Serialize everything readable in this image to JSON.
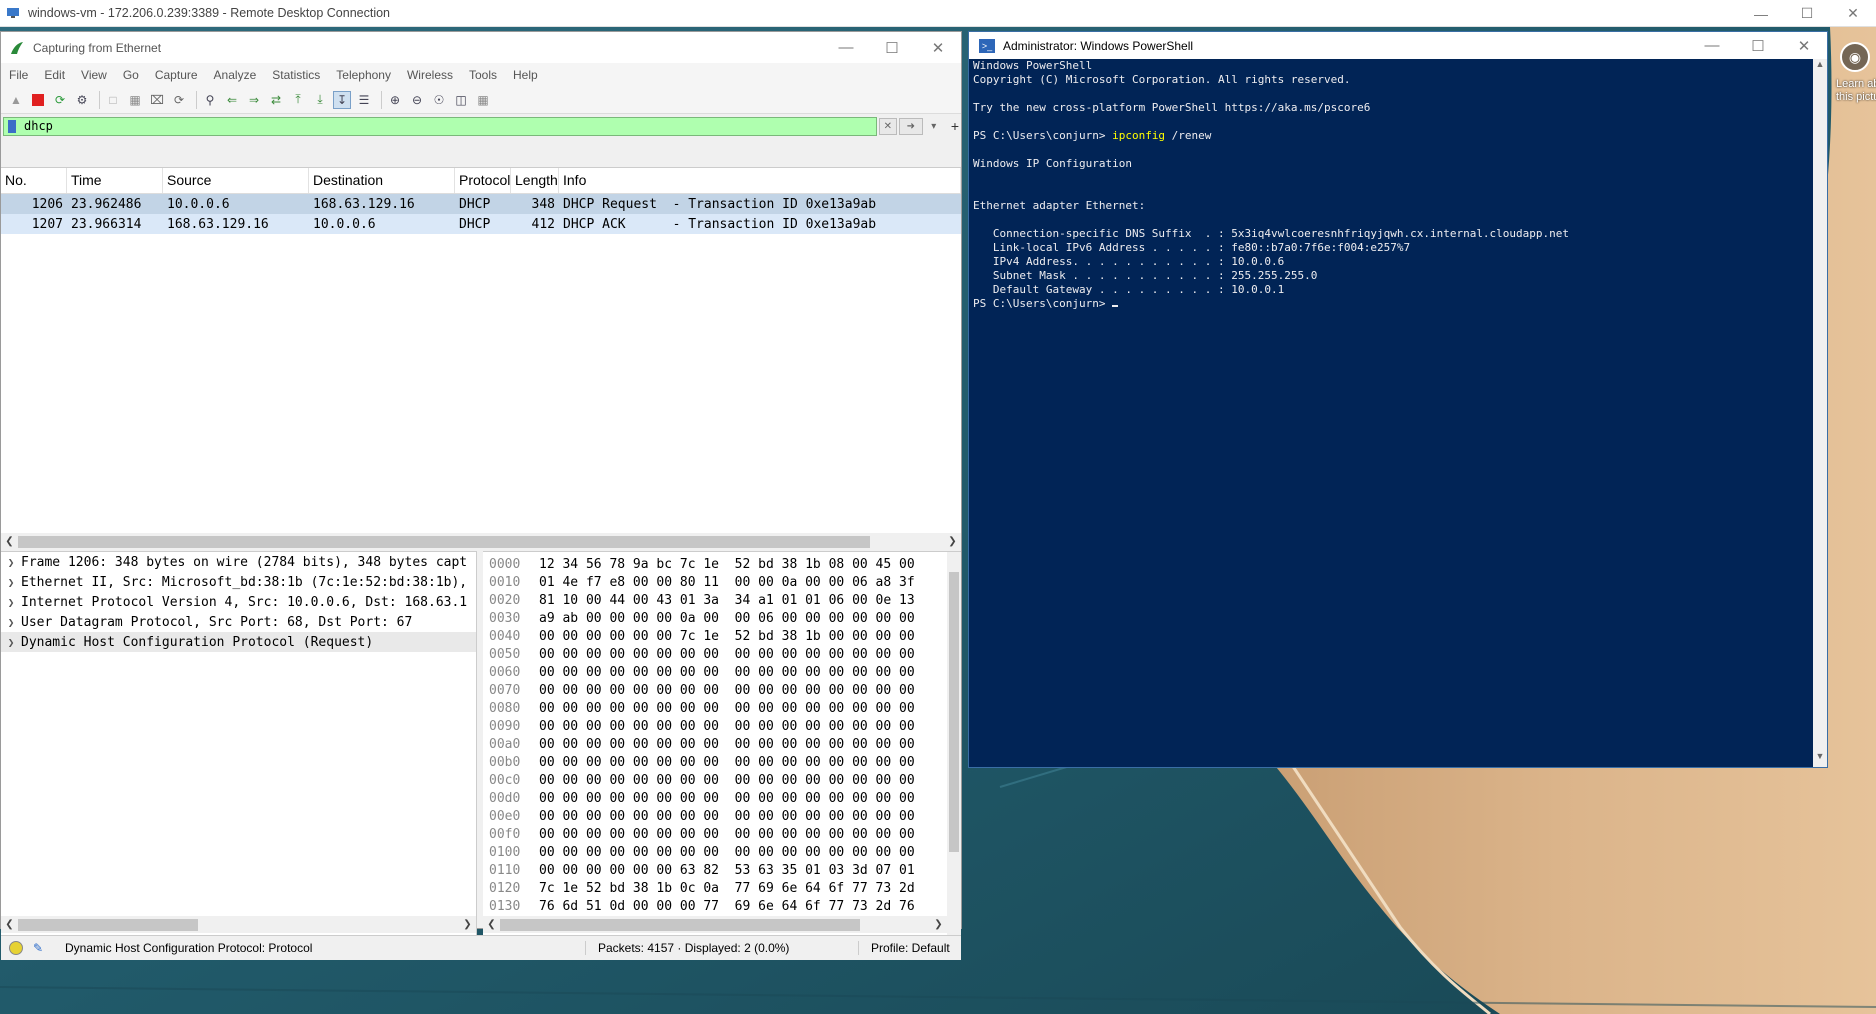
{
  "rdp": {
    "title": "windows-vm - 172.206.0.239:3389 - Remote Desktop Connection"
  },
  "wireshark": {
    "title": "Capturing from Ethernet",
    "menu": [
      "File",
      "Edit",
      "View",
      "Go",
      "Capture",
      "Analyze",
      "Statistics",
      "Telephony",
      "Wireless",
      "Tools",
      "Help"
    ],
    "filter": "dhcp",
    "columns": [
      "No.",
      "Time",
      "Source",
      "Destination",
      "Protocol",
      "Length",
      "Info"
    ],
    "packets": [
      {
        "no": "1206",
        "time": "23.962486",
        "src": "10.0.0.6",
        "dst": "168.63.129.16",
        "proto": "DHCP",
        "len": "348",
        "info": "DHCP Request  - Transaction ID 0xe13a9ab"
      },
      {
        "no": "1207",
        "time": "23.966314",
        "src": "168.63.129.16",
        "dst": "10.0.0.6",
        "proto": "DHCP",
        "len": "412",
        "info": "DHCP ACK      - Transaction ID 0xe13a9ab"
      }
    ],
    "details": [
      "Frame 1206: 348 bytes on wire (2784 bits), 348 bytes capt",
      "Ethernet II, Src: Microsoft_bd:38:1b (7c:1e:52:bd:38:1b),",
      "Internet Protocol Version 4, Src: 10.0.0.6, Dst: 168.63.1",
      "User Datagram Protocol, Src Port: 68, Dst Port: 67",
      "Dynamic Host Configuration Protocol (Request)"
    ],
    "bytes": [
      {
        "off": "0000",
        "hex": "12 34 56 78 9a bc 7c 1e  52 bd 38 1b 08 00 45 00"
      },
      {
        "off": "0010",
        "hex": "01 4e f7 e8 00 00 80 11  00 00 0a 00 00 06 a8 3f"
      },
      {
        "off": "0020",
        "hex": "81 10 00 44 00 43 01 3a  34 a1 01 01 06 00 0e 13"
      },
      {
        "off": "0030",
        "hex": "a9 ab 00 00 00 00 0a 00  00 06 00 00 00 00 00 00"
      },
      {
        "off": "0040",
        "hex": "00 00 00 00 00 00 7c 1e  52 bd 38 1b 00 00 00 00"
      },
      {
        "off": "0050",
        "hex": "00 00 00 00 00 00 00 00  00 00 00 00 00 00 00 00"
      },
      {
        "off": "0060",
        "hex": "00 00 00 00 00 00 00 00  00 00 00 00 00 00 00 00"
      },
      {
        "off": "0070",
        "hex": "00 00 00 00 00 00 00 00  00 00 00 00 00 00 00 00"
      },
      {
        "off": "0080",
        "hex": "00 00 00 00 00 00 00 00  00 00 00 00 00 00 00 00"
      },
      {
        "off": "0090",
        "hex": "00 00 00 00 00 00 00 00  00 00 00 00 00 00 00 00"
      },
      {
        "off": "00a0",
        "hex": "00 00 00 00 00 00 00 00  00 00 00 00 00 00 00 00"
      },
      {
        "off": "00b0",
        "hex": "00 00 00 00 00 00 00 00  00 00 00 00 00 00 00 00"
      },
      {
        "off": "00c0",
        "hex": "00 00 00 00 00 00 00 00  00 00 00 00 00 00 00 00"
      },
      {
        "off": "00d0",
        "hex": "00 00 00 00 00 00 00 00  00 00 00 00 00 00 00 00"
      },
      {
        "off": "00e0",
        "hex": "00 00 00 00 00 00 00 00  00 00 00 00 00 00 00 00"
      },
      {
        "off": "00f0",
        "hex": "00 00 00 00 00 00 00 00  00 00 00 00 00 00 00 00"
      },
      {
        "off": "0100",
        "hex": "00 00 00 00 00 00 00 00  00 00 00 00 00 00 00 00"
      },
      {
        "off": "0110",
        "hex": "00 00 00 00 00 00 63 82  53 63 35 01 03 3d 07 01"
      },
      {
        "off": "0120",
        "hex": "7c 1e 52 bd 38 1b 0c 0a  77 69 6e 64 6f 77 73 2d"
      },
      {
        "off": "0130",
        "hex": "76 6d 51 0d 00 00 00 77  69 6e 64 6f 77 73 2d 76"
      }
    ],
    "status": {
      "field": "Dynamic Host Configuration Protocol: Protocol",
      "packets": "Packets: 4157 · Displayed: 2 (0.0%)",
      "profile": "Profile: Default"
    }
  },
  "powershell": {
    "title": "Administrator: Windows PowerShell",
    "lines": {
      "l1": "Windows PowerShell",
      "l2": "Copyright (C) Microsoft Corporation. All rights reserved.",
      "l3": "Try the new cross-platform PowerShell https://aka.ms/pscore6",
      "prompt": "PS C:\\Users\\conjurn> ",
      "cmd": "ipconfig",
      "arg": " /renew",
      "l5": "Windows IP Configuration",
      "l6": "Ethernet adapter Ethernet:",
      "l7": "   Connection-specific DNS Suffix  . : 5x3iq4vwlcoeresnhfriqyjqwh.cx.internal.cloudapp.net",
      "l8": "   Link-local IPv6 Address . . . . . : fe80::b7a0:7f6e:f004:e257%7",
      "l9": "   IPv4 Address. . . . . . . . . . . : 10.0.0.6",
      "l10": "   Subnet Mask . . . . . . . . . . . : 255.255.255.0",
      "l11": "   Default Gateway . . . . . . . . . : 10.0.0.1",
      "prompt2": "PS C:\\Users\\conjurn> "
    }
  },
  "side_widget": {
    "line1": "Learn abo",
    "line2": "this pictu"
  }
}
